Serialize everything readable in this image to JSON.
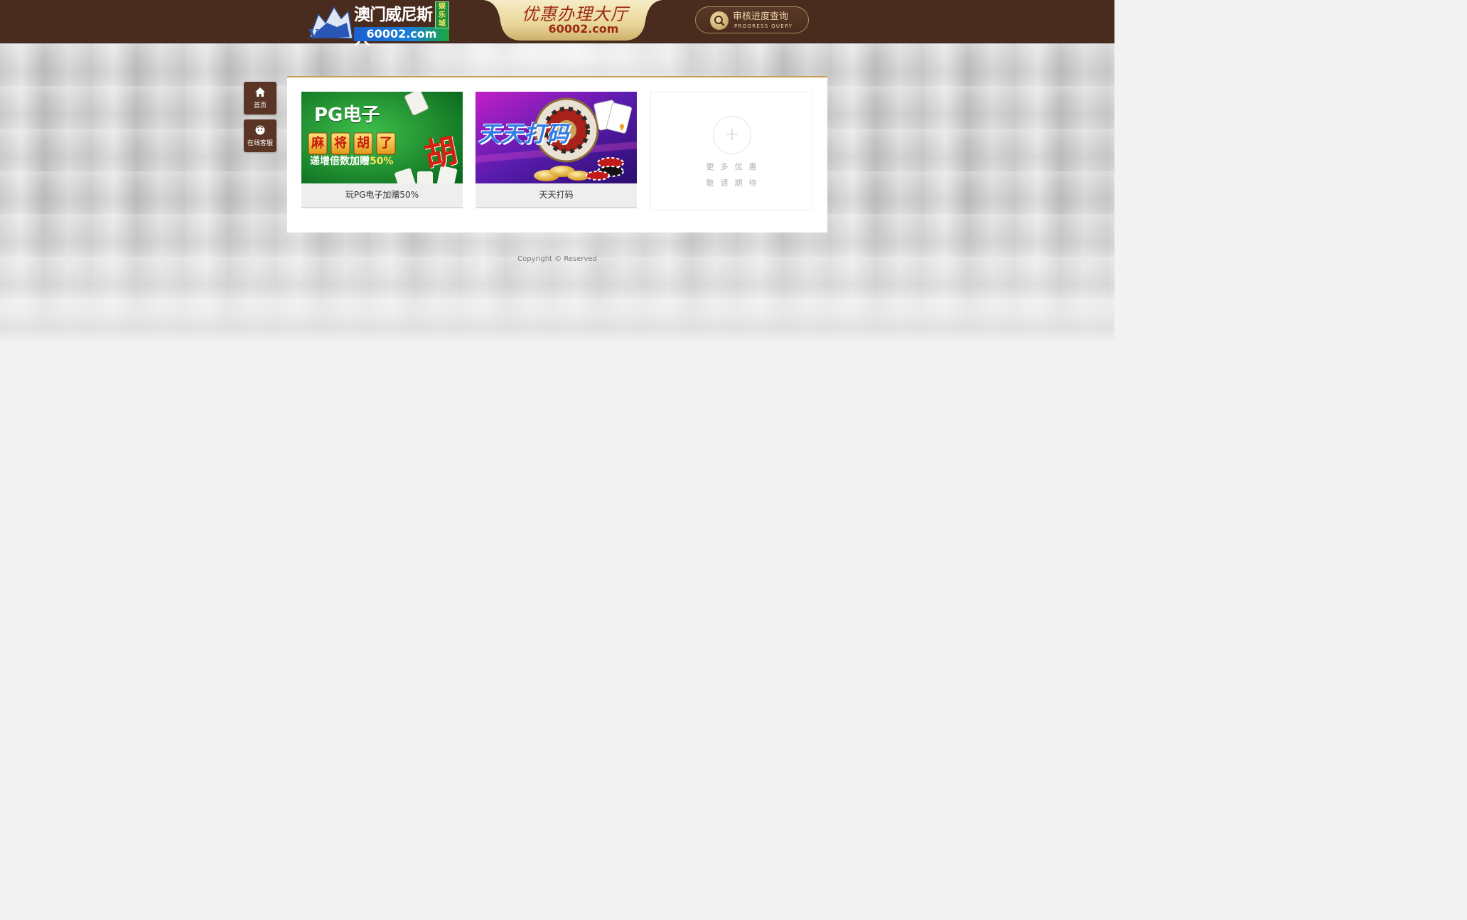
{
  "header": {
    "logo": {
      "title": "澳门威尼斯人",
      "url": "60002.com",
      "badge": "娱乐城"
    },
    "center_tab": {
      "title": "优惠办理大厅",
      "url": "60002.com"
    },
    "progress_button": {
      "label": "审核进度查询",
      "sublabel": "PROGRESS QUERY"
    }
  },
  "side_nav": {
    "items": [
      {
        "label": "首页",
        "icon": "home-icon"
      },
      {
        "label": "在线客服",
        "icon": "customer-service-icon"
      }
    ]
  },
  "promos": [
    {
      "caption": "玩PG电子加赠50%",
      "banner": {
        "line1": "PG电子",
        "line2": [
          "麻",
          "将",
          "胡",
          "了"
        ],
        "line3_prefix": "递增倍数加赠",
        "line3_value": "50%",
        "corner": "胡"
      }
    },
    {
      "caption": "天天打码",
      "banner": {
        "headline": "天天打码"
      }
    }
  ],
  "more_card": {
    "line1": "更多优惠",
    "line2": "敬请期待"
  },
  "footer": {
    "copyright": "Copyright © Reserved"
  },
  "colors": {
    "header_bg": "#4a2c1e",
    "gold_accent": "#c6a25b",
    "side_button_bg": "#5a3424",
    "page_bg": "#f2f2f2"
  }
}
